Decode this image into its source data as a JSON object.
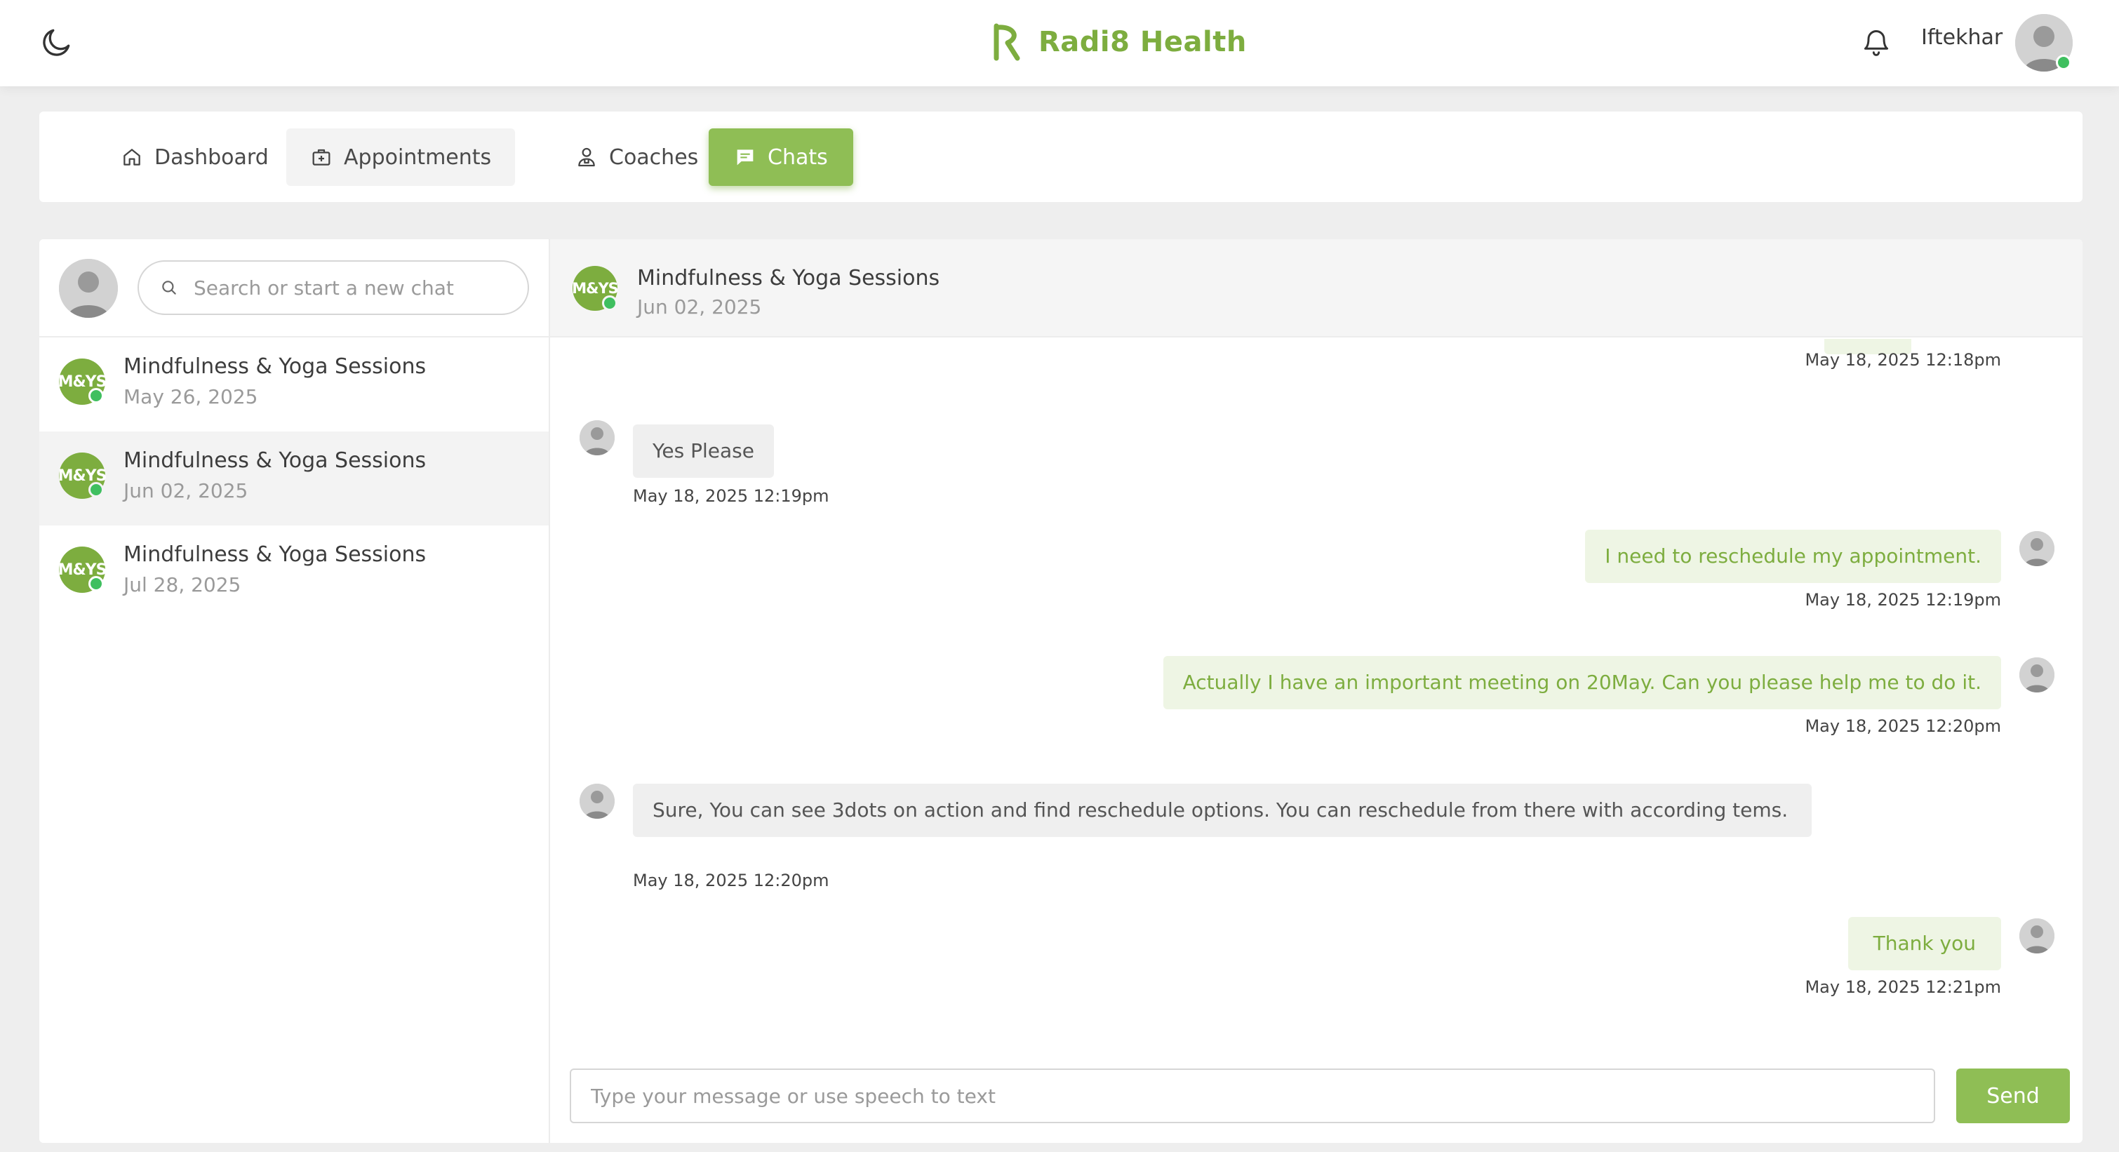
{
  "header": {
    "brand_name": "Radi8 Health",
    "user_name": "Iftekhar",
    "theme_icon": "moon-icon",
    "notification_icon": "bell-icon"
  },
  "nav": {
    "tabs": [
      {
        "label": "Dashboard",
        "icon": "home-icon"
      },
      {
        "label": "Appointments",
        "icon": "medical-bag-icon"
      },
      {
        "label": "Coaches",
        "icon": "doctor-icon"
      },
      {
        "label": "Chats",
        "icon": "chat-icon",
        "active": true
      }
    ]
  },
  "sidebar": {
    "search_placeholder": "Search or start a new chat",
    "conversations": [
      {
        "initials": "M&YS",
        "title": "Mindfulness & Yoga Sessions",
        "date": "May 26, 2025"
      },
      {
        "initials": "M&YS",
        "title": "Mindfulness & Yoga Sessions",
        "date": "Jun 02, 2025",
        "selected": true
      },
      {
        "initials": "M&YS",
        "title": "Mindfulness & Yoga Sessions",
        "date": "Jul 28, 2025"
      }
    ]
  },
  "chat": {
    "initials": "M&YS",
    "title": "Mindfulness & Yoga Sessions",
    "date": "Jun 02, 2025",
    "messages": [
      {
        "direction": "out",
        "text": "",
        "time": "May 18, 2025 12:18pm"
      },
      {
        "direction": "in",
        "text": "Yes Please",
        "time": "May 18, 2025 12:19pm"
      },
      {
        "direction": "out",
        "text": "I need to reschedule my appointment.",
        "time": "May 18, 2025 12:19pm"
      },
      {
        "direction": "out",
        "text": "Actually I have an important meeting on 20May. Can you please help me to do it.",
        "time": "May 18, 2025 12:20pm"
      },
      {
        "direction": "in",
        "text": "Sure, You can see 3dots on action and find reschedule options. You can reschedule from there with according tems.",
        "time": "May 18, 2025 12:20pm"
      },
      {
        "direction": "out",
        "text": "Thank you",
        "time": "May 18, 2025 12:21pm"
      }
    ],
    "composer_placeholder": "Type your message or use speech to text",
    "send_label": "Send"
  },
  "colors": {
    "brand": "#7dad3f",
    "active_tab": "#8fbe55",
    "outgoing_bubble": "#eef5e4",
    "incoming_bubble": "#efefef",
    "online": "#3fbf5f"
  }
}
